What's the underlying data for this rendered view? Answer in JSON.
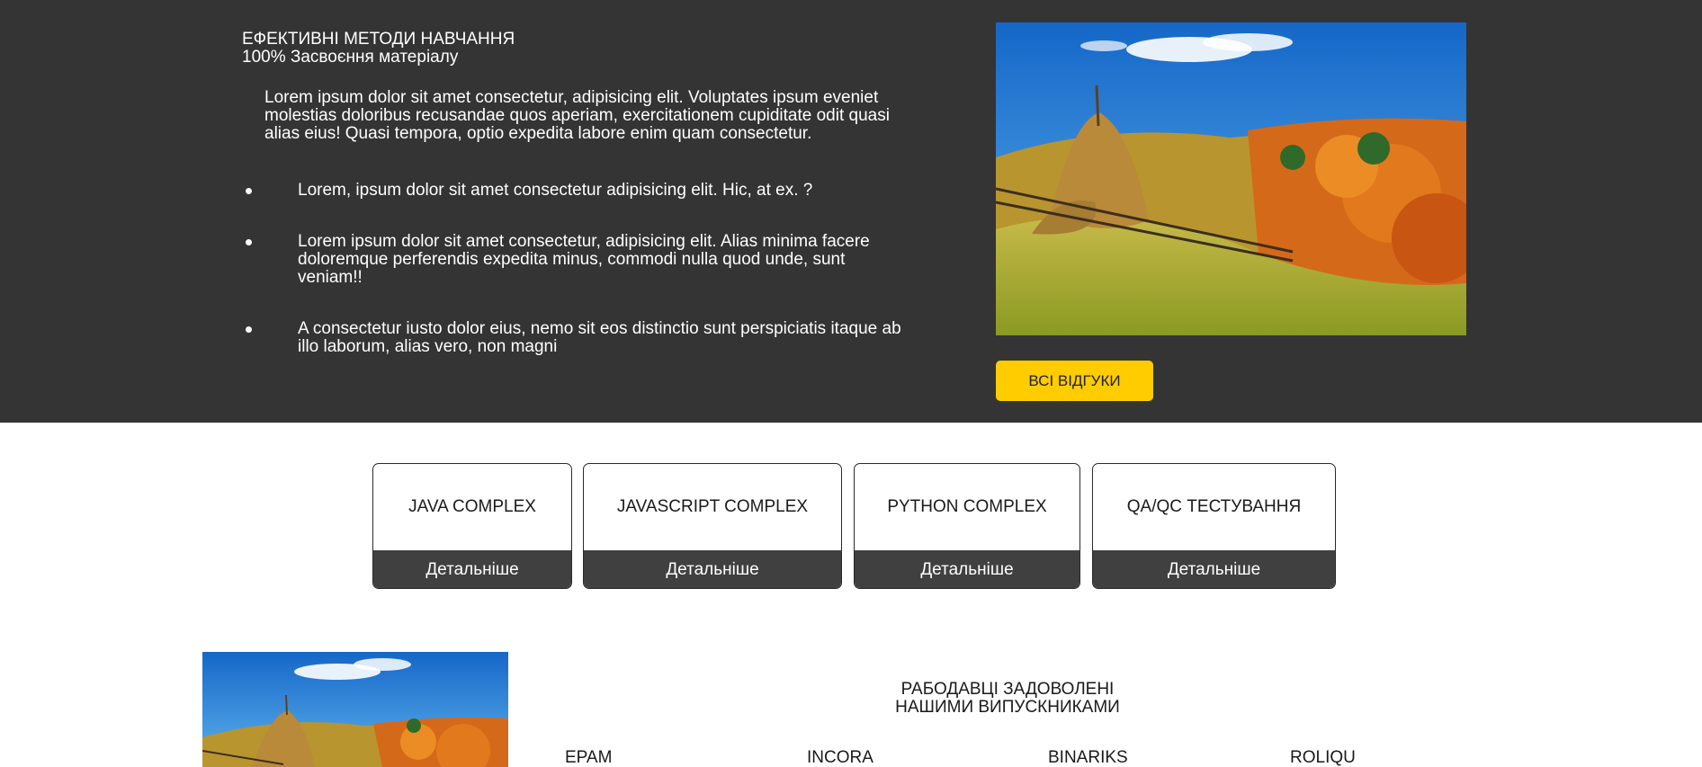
{
  "hero": {
    "title": "ЕФЕКТИВНІ МЕТОДИ НАВЧАННЯ",
    "subtitle": "100% Засвоєння матеріалу",
    "intro": "Lorem ipsum dolor sit amet consectetur, adipisicing elit. Voluptates ipsum eveniet molestias doloribus recusandae quos aperiam, exercitationem cupiditate odit quasi alias eius! Quasi tempora, optio expedita labore enim quam consectetur.",
    "items": [
      "Lorem, ipsum dolor sit amet consectetur adipisicing elit. Hic, at ex. ?",
      "Lorem ipsum dolor sit amet consectetur, adipisicing elit. Alias minima facere doloremque perferendis expedita minus, commodi nulla quod unde, sunt veniam!!",
      "A consectetur iusto dolor eius, nemo sit eos distinctio sunt perspiciatis itaque ab illo laborum, alias vero, non magni"
    ],
    "photo_icon": "landscape-photo",
    "reviews_button": "ВСІ ВІДГУКИ",
    "accent_color": "#ffcc00",
    "background_color": "#343434"
  },
  "courses": [
    {
      "title": "JAVA COMPLEX",
      "more": "Детальніше"
    },
    {
      "title": "JAVASCRIPT COMPLEX",
      "more": "Детальніше"
    },
    {
      "title": "PYTHON COMPLEX",
      "more": "Детальніше"
    },
    {
      "title": "QA/QC ТЕСТУВАННЯ",
      "more": "Детальніше"
    }
  ],
  "employers": {
    "heading_line1": "РАБОДАВЦІ ЗАДОВОЛЕНІ",
    "heading_line2": "НАШИМИ ВИПУСКНИКАМИ",
    "companies": [
      "EPAM",
      "INCORA",
      "BINARIKS",
      "ROLIQU"
    ]
  }
}
